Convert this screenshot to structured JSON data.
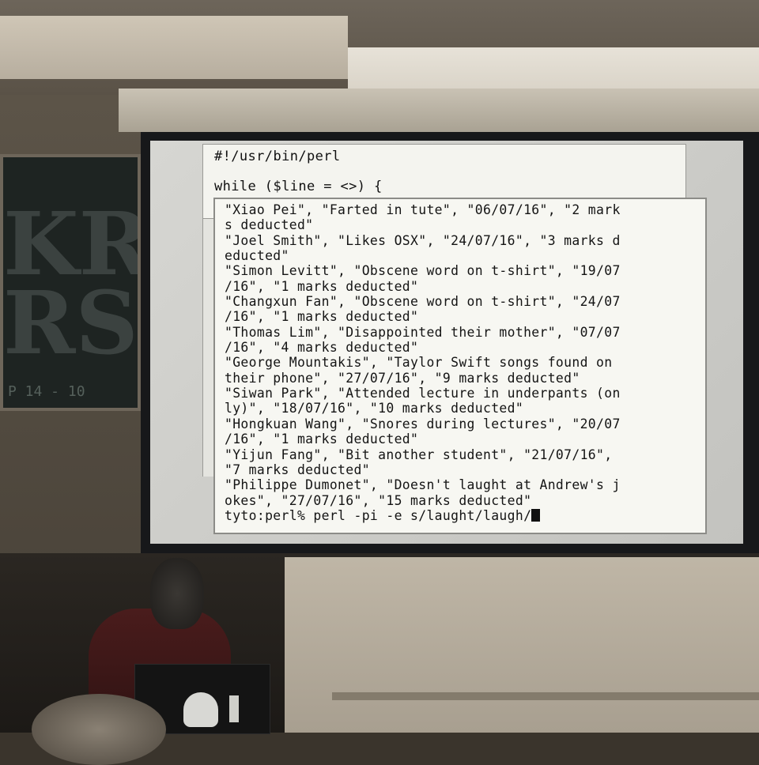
{
  "terminal_back": {
    "lines": [
      "#!/usr/bin/perl",
      "while ($line = <>) {"
    ]
  },
  "terminal_front": {
    "lines": [
      "\"Xiao Pei\", \"Farted in tute\", \"06/07/16\", \"2 mark",
      "s deducted\"",
      "\"Joel Smith\", \"Likes OSX\", \"24/07/16\", \"3 marks d",
      "educted\"",
      "\"Simon Levitt\", \"Obscene word on t-shirt\", \"19/07",
      "/16\", \"1 marks deducted\"",
      "\"Changxun Fan\", \"Obscene word on t-shirt\", \"24/07",
      "/16\", \"1 marks deducted\"",
      "\"Thomas Lim\", \"Disappointed their mother\", \"07/07",
      "/16\", \"4 marks deducted\"",
      "\"George Mountakis\", \"Taylor Swift songs found on",
      "their phone\", \"27/07/16\", \"9 marks deducted\"",
      "\"Siwan Park\", \"Attended lecture in underpants (on",
      "ly)\", \"18/07/16\", \"10 marks deducted\"",
      "\"Hongkuan Wang\", \"Snores during lectures\", \"20/07",
      "/16\", \"1 marks deducted\"",
      "\"Yijun Fang\", \"Bit another student\", \"21/07/16\",",
      "\"7 marks deducted\"",
      "\"Philippe Dumonet\", \"Doesn't laught at Andrew's j",
      "okes\", \"27/07/16\", \"15 marks deducted\""
    ],
    "prompt": "tyto:perl% ",
    "command": "perl -pi -e s/laught/laugh/"
  },
  "poster": {
    "letters": "KR\nRS",
    "footer": "P 14 - 10"
  }
}
